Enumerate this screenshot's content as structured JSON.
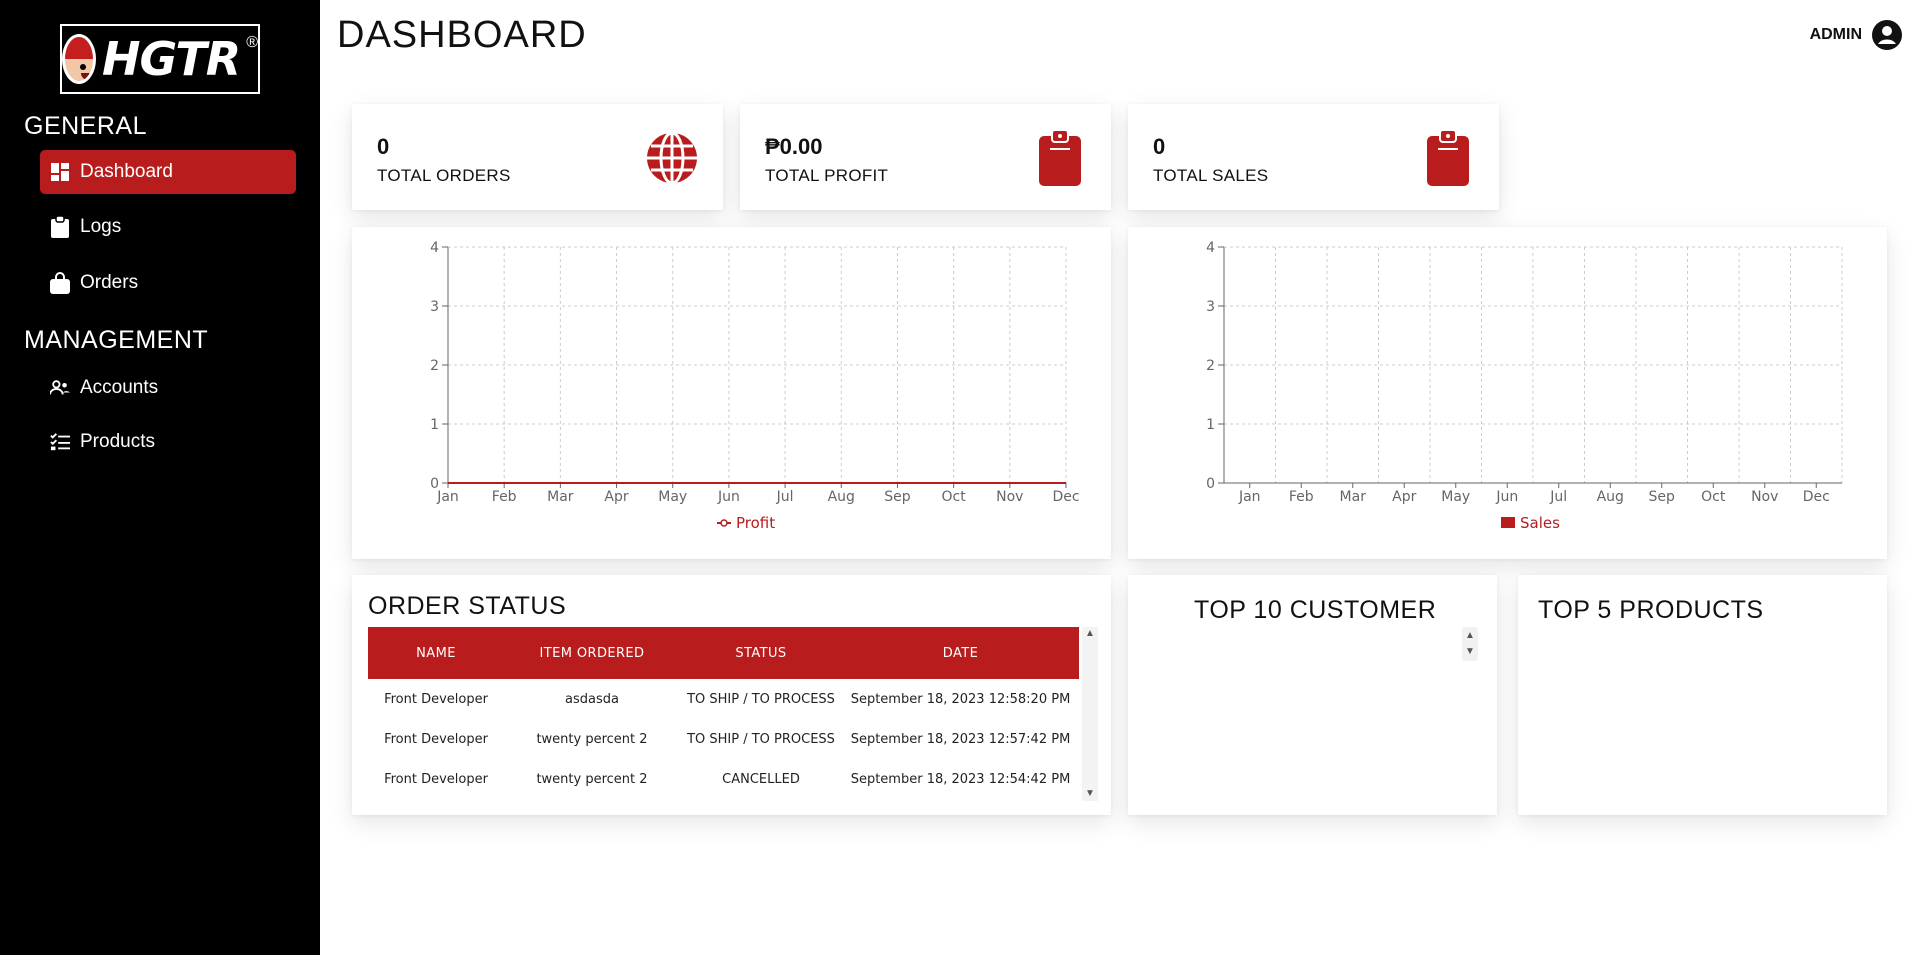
{
  "app": {
    "logo_text": "HGTR",
    "logo_reg": "®"
  },
  "sidebar": {
    "sections": [
      {
        "title": "GENERAL"
      },
      {
        "title": "MANAGEMENT"
      }
    ],
    "items": [
      {
        "label": "Dashboard",
        "icon": "dashboard-icon",
        "active": true
      },
      {
        "label": "Logs",
        "icon": "clipboard-icon"
      },
      {
        "label": "Orders",
        "icon": "shopping-bag-icon"
      },
      {
        "label": "Accounts",
        "icon": "users-icon"
      },
      {
        "label": "Products",
        "icon": "checklist-icon"
      }
    ]
  },
  "header": {
    "title": "DASHBOARD",
    "user": "ADMIN"
  },
  "stats": [
    {
      "value": "0",
      "label": "TOTAL ORDERS",
      "icon": "globe-icon"
    },
    {
      "value": "₱0.00",
      "label": "TOTAL PROFIT",
      "icon": "clipboard-icon"
    },
    {
      "value": "0",
      "label": "TOTAL SALES",
      "icon": "clipboard-icon"
    }
  ],
  "chart_data": [
    {
      "type": "line",
      "categories": [
        "Jan",
        "Feb",
        "Mar",
        "Apr",
        "May",
        "Jun",
        "Jul",
        "Aug",
        "Sep",
        "Oct",
        "Nov",
        "Dec"
      ],
      "series": [
        {
          "name": "Profit",
          "values": [
            0,
            0,
            0,
            0,
            0,
            0,
            0,
            0,
            0,
            0,
            0,
            0
          ]
        }
      ],
      "yticks": [
        "0",
        "1",
        "2",
        "3",
        "4"
      ],
      "ylim": [
        0,
        4
      ],
      "grid": true,
      "legend": "bottom",
      "color": "#b81c1c"
    },
    {
      "type": "bar",
      "categories": [
        "Jan",
        "Feb",
        "Mar",
        "Apr",
        "May",
        "Jun",
        "Jul",
        "Aug",
        "Sep",
        "Oct",
        "Nov",
        "Dec"
      ],
      "series": [
        {
          "name": "Sales",
          "values": [
            0,
            0,
            0,
            0,
            0,
            0,
            0,
            0,
            0,
            0,
            0,
            0
          ]
        }
      ],
      "yticks": [
        "0",
        "1",
        "2",
        "3",
        "4"
      ],
      "ylim": [
        0,
        4
      ],
      "grid": true,
      "legend": "bottom",
      "color": "#b81c1c"
    }
  ],
  "order_status": {
    "title": "ORDER STATUS",
    "columns": [
      "NAME",
      "ITEM ORDERED",
      "STATUS",
      "DATE"
    ],
    "rows": [
      [
        "Front Developer",
        "asdasda",
        "TO SHIP / TO PROCESS",
        "September 18, 2023 12:58:20 PM"
      ],
      [
        "Front Developer",
        "twenty percent 2",
        "TO SHIP / TO PROCESS",
        "September 18, 2023 12:57:42 PM"
      ],
      [
        "Front Developer",
        "twenty percent 2",
        "CANCELLED",
        "September 18, 2023 12:54:42 PM"
      ]
    ]
  },
  "top_customers": {
    "title": "TOP 10 CUSTOMER"
  },
  "top_products": {
    "title": "TOP 5 PRODUCTS"
  },
  "colors": {
    "accent": "#b81c1c",
    "sidebar": "#000000"
  }
}
